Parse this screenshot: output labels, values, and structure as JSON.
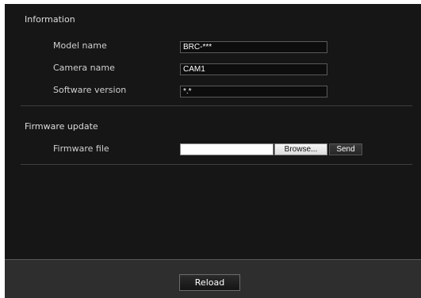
{
  "information": {
    "title": "Information",
    "rows": [
      {
        "label": "Model name",
        "value": "BRC-***"
      },
      {
        "label": "Camera name",
        "value": "CAM1"
      },
      {
        "label": "Software version",
        "value": "*.*"
      }
    ]
  },
  "firmware": {
    "title": "Firmware update",
    "file_label": "Firmware file",
    "file_value": "",
    "browse_label": "Browse...",
    "send_label": "Send"
  },
  "footer": {
    "reload_label": "Reload"
  }
}
